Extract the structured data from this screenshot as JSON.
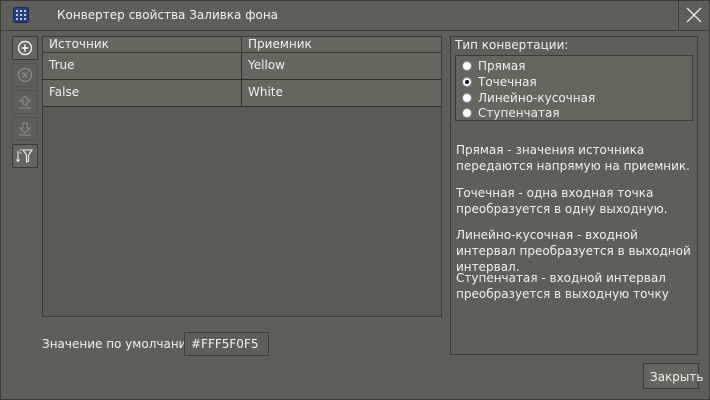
{
  "window": {
    "title": "Конвертер свойства Заливка фона",
    "app_icon": "grid-app-icon",
    "close_icon": "close-icon"
  },
  "toolbar": {
    "buttons": [
      {
        "name": "add-row-button",
        "icon": "plus-circle-icon",
        "enabled": true
      },
      {
        "name": "remove-row-button",
        "icon": "x-circle-icon",
        "enabled": false
      },
      {
        "name": "move-up-button",
        "icon": "arrow-up-icon",
        "enabled": false
      },
      {
        "name": "move-down-button",
        "icon": "arrow-down-icon",
        "enabled": false
      },
      {
        "name": "sort-filter-button",
        "icon": "sort-filter-icon",
        "enabled": true
      }
    ]
  },
  "grid": {
    "columns": [
      "Источник",
      "Приемник"
    ],
    "rows": [
      {
        "source": "True",
        "target": "Yellow"
      },
      {
        "source": "False",
        "target": "White"
      }
    ]
  },
  "default_value": {
    "label": "Значение по умолчанию",
    "value": "#FFF5F0F5"
  },
  "conversion": {
    "label": "Тип конвертации:",
    "options": [
      {
        "label": "Прямая",
        "checked": false
      },
      {
        "label": "Точечная",
        "checked": true
      },
      {
        "label": "Линейно-кусочная",
        "checked": false
      },
      {
        "label": "Ступенчатая",
        "checked": false
      }
    ],
    "descriptions": [
      "Прямая - значения источника передаются напрямую на приемник.",
      "Точечная - одна входная точка преобразуется в одну выходную.",
      "Линейно-кусочная - входной интервал преобразуется в выходной интервал.",
      "Ступенчатая - входной интервал преобразуется в выходную точку"
    ]
  },
  "footer": {
    "close_label": "Закрыть"
  },
  "colors": {
    "background": "#5f5f5a",
    "border": "#3a3a37",
    "text": "#f0f0f0"
  }
}
